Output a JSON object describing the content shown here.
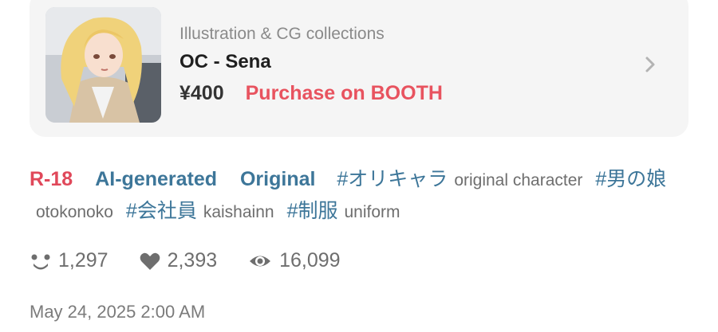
{
  "product": {
    "category": "Illustration & CG collections",
    "title": "OC - Sena",
    "price": "¥400",
    "purchase_link": "Purchase on BOOTH"
  },
  "tags": {
    "r18": "R-18",
    "ai": "AI-generated",
    "original": "Original",
    "items": [
      {
        "tag": "#オリキャラ",
        "translation": "original character"
      },
      {
        "tag": "#男の娘",
        "translation": "otokonoko"
      },
      {
        "tag": "#会社員",
        "translation": "kaishainn"
      },
      {
        "tag": "#制服",
        "translation": "uniform"
      }
    ]
  },
  "stats": {
    "users": "1,297",
    "likes": "2,393",
    "views": "16,099"
  },
  "date": "May 24, 2025 2:00 AM",
  "colors": {
    "r18": "#e0485a",
    "tag": "#3d7699",
    "purchase": "#e8535f",
    "card_bg": "#f5f5f5"
  },
  "icons": [
    "chevron-right-icon",
    "users-icon",
    "heart-icon",
    "eye-icon"
  ]
}
